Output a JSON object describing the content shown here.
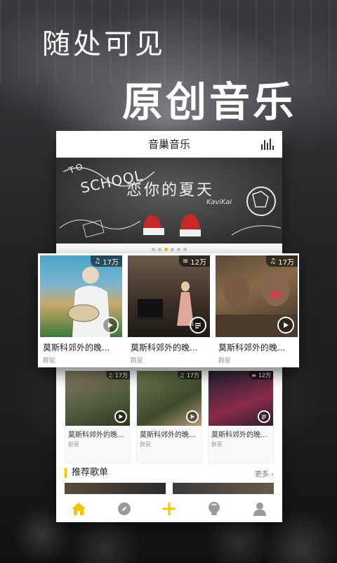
{
  "promo": {
    "headline_top": "随处可见",
    "headline_main": "原创音乐"
  },
  "app": {
    "title": "音巢音乐",
    "header_icon": "equalizer-icon"
  },
  "banner": {
    "title": "恋你的夏天",
    "subtitle": "KaviKai",
    "doodle_text_1": "TO",
    "doodle_text_2": "SCHOOL",
    "carousel_count": 6,
    "carousel_active_index": 2
  },
  "featured_cards": [
    {
      "title": "莫斯科郊外的晚...",
      "artist": "群星",
      "count": "17万",
      "count_icon": "headphones-icon",
      "action_icon": "play-icon"
    },
    {
      "title": "莫斯科郊外的晚...",
      "artist": "群星",
      "count": "12万",
      "count_icon": "playlist-icon",
      "action_icon": "playlist-icon"
    },
    {
      "title": "莫斯科郊外的晚...",
      "artist": "群星",
      "count": "17万",
      "count_icon": "headphones-icon",
      "action_icon": "play-icon"
    }
  ],
  "grid_cards": [
    {
      "title": "莫斯科郊外的晚...",
      "artist": "群星",
      "count": "17万",
      "count_icon": "headphones-icon",
      "action_icon": "play-icon"
    },
    {
      "title": "莫斯科郊外的晚...",
      "artist": "群星",
      "count": "17万",
      "count_icon": "headphones-icon",
      "action_icon": "play-icon"
    },
    {
      "title": "莫斯科郊外的晚...",
      "artist": "群星",
      "count": "12万",
      "count_icon": "playlist-icon",
      "action_icon": "playlist-icon"
    }
  ],
  "recommended": {
    "title": "推荐歌单",
    "more_label": "更多"
  },
  "tabbar": [
    "home-icon",
    "discover-compass-icon",
    "add-icon",
    "bulb-icon",
    "profile-icon"
  ],
  "colors": {
    "accent": "#f5c400",
    "tab_inactive": "#9a9a9a"
  }
}
